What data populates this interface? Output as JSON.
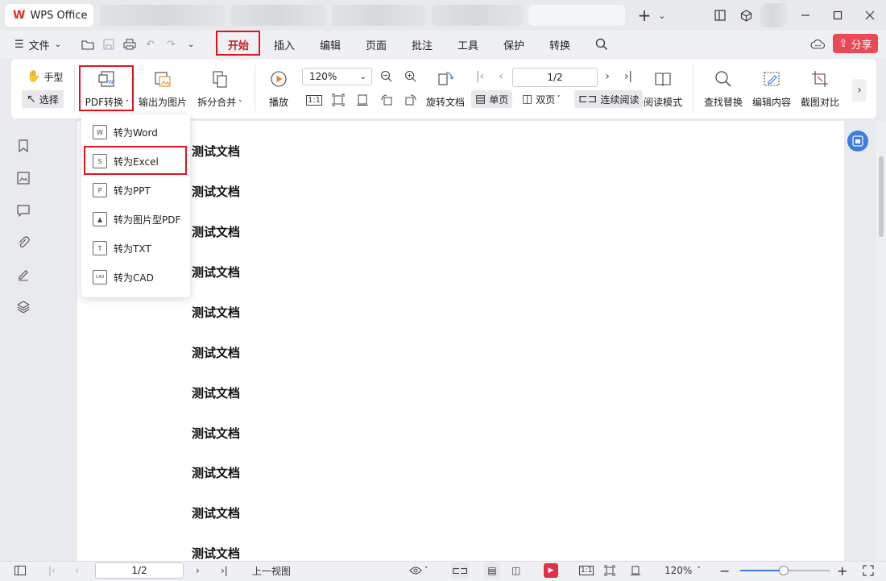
{
  "titlebar": {
    "app_name": "WPS Office",
    "logo": "W",
    "new_tab": "+",
    "new_tab_chevron": "⌄"
  },
  "menubar": {
    "file_label": "文件",
    "tabs": [
      {
        "label": "开始",
        "active": true
      },
      {
        "label": "插入"
      },
      {
        "label": "编辑"
      },
      {
        "label": "页面"
      },
      {
        "label": "批注"
      },
      {
        "label": "工具"
      },
      {
        "label": "保护"
      },
      {
        "label": "转换"
      }
    ],
    "share_label": "分享"
  },
  "ribbon": {
    "hand_label": "手型",
    "select_label": "选择",
    "pdf_convert_label": "PDF转换",
    "export_image_label": "输出为图片",
    "split_merge_label": "拆分合并",
    "play_label": "播放",
    "zoom_value": "120%",
    "page_value": "1/2",
    "rotate_label": "旋转文档",
    "single_page_label": "单页",
    "double_page_label": "双页",
    "continuous_label": "连续阅读",
    "read_mode_label": "阅读模式",
    "find_replace_label": "查找替换",
    "edit_content_label": "编辑内容",
    "screenshot_compare_label": "截图对比"
  },
  "dropdown": {
    "items": [
      {
        "label": "转为Word",
        "icon": "W"
      },
      {
        "label": "转为Excel",
        "icon": "S"
      },
      {
        "label": "转为PPT",
        "icon": "P"
      },
      {
        "label": "转为图片型PDF",
        "icon": "▲"
      },
      {
        "label": "转为TXT",
        "icon": "T"
      },
      {
        "label": "转为CAD",
        "icon": "CAD"
      }
    ]
  },
  "document": {
    "lines": [
      "测试文档",
      "测试文档",
      "测试文档",
      "测试文档",
      "测试文档",
      "测试文档",
      "测试文档",
      "测试文档",
      "测试文档",
      "测试文档",
      "测试文档"
    ]
  },
  "statusbar": {
    "page_value": "1/2",
    "prev_view_label": "上一视图",
    "zoom_value": "120%"
  },
  "colors": {
    "accent_red": "#e0141e",
    "share_bg": "#e94a55",
    "active_tab": "#c8232c",
    "blue": "#3b7de0"
  }
}
